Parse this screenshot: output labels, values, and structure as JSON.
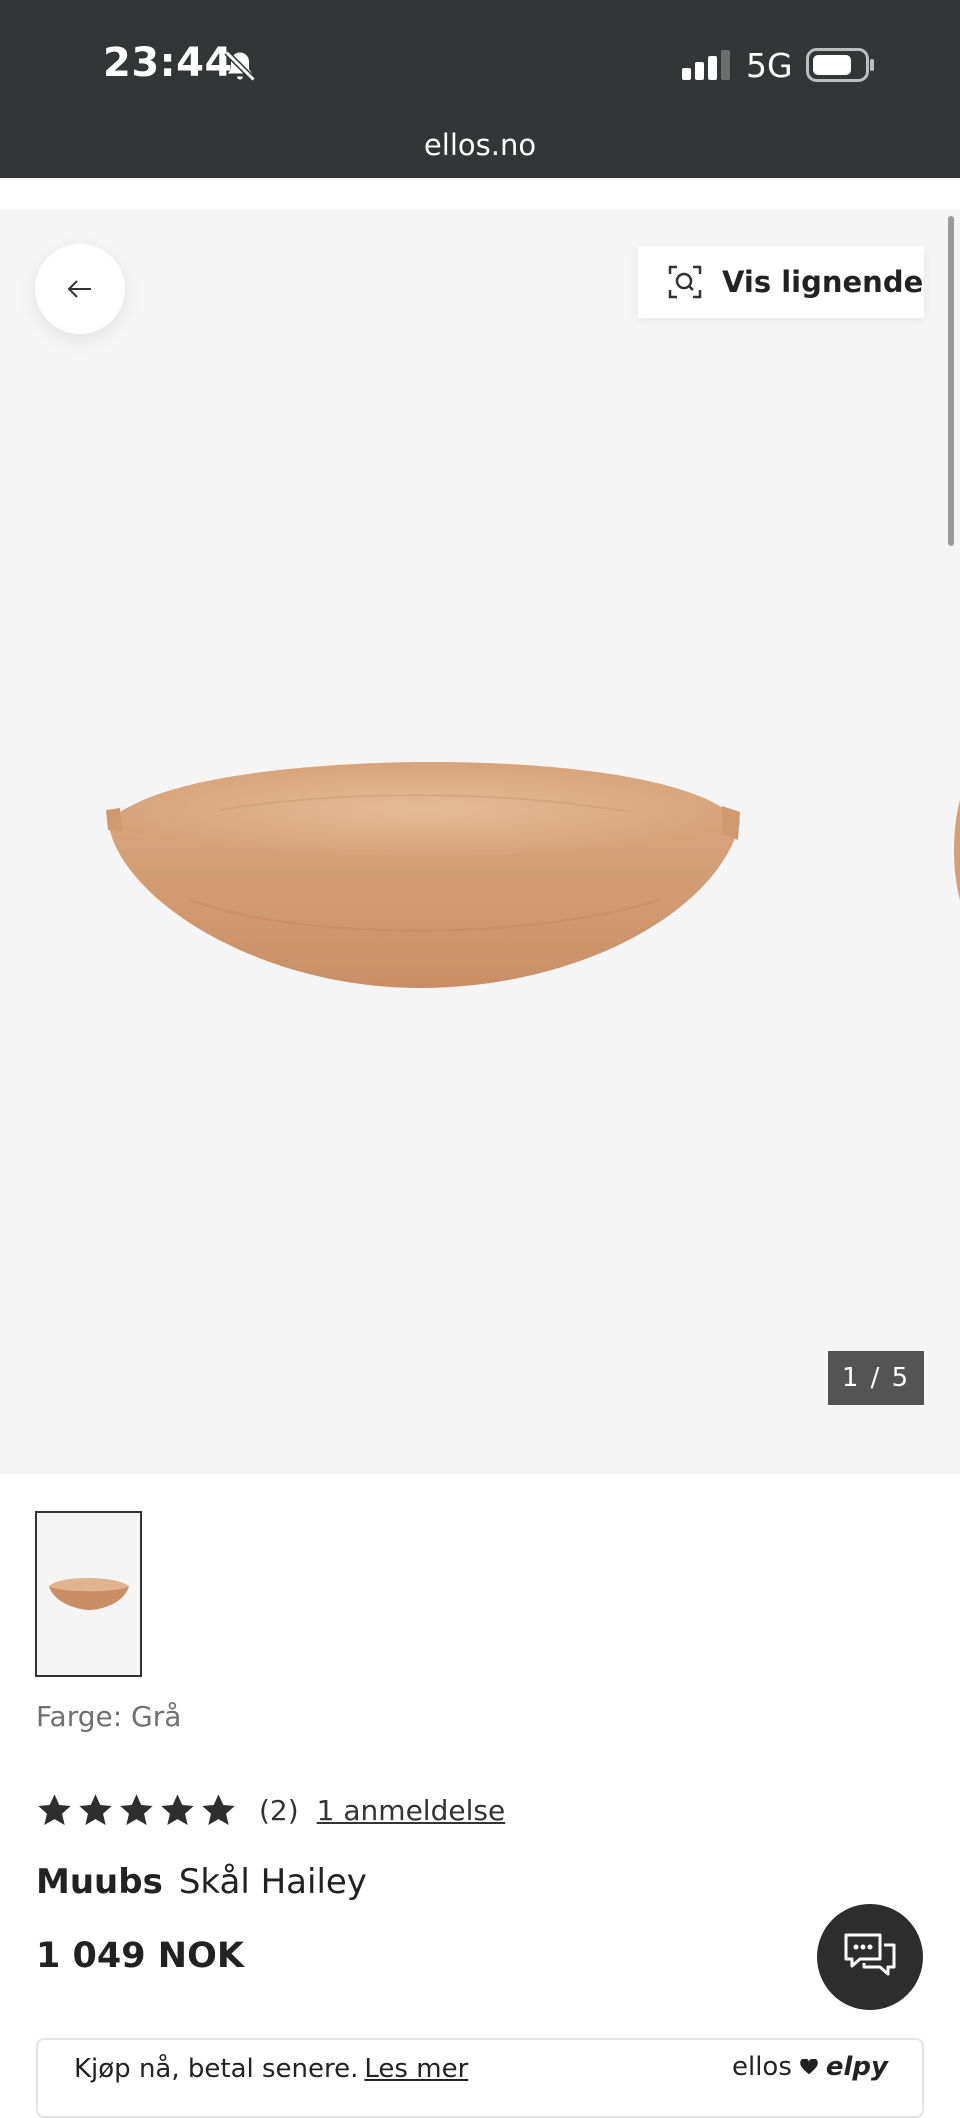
{
  "status_bar": {
    "time": "23:44",
    "network": "5G",
    "url": "ellos.no"
  },
  "gallery": {
    "similar_label": "Vis lignende",
    "counter": "1 / 5"
  },
  "product": {
    "color_label": "Farge: Grå",
    "rating_stars": 5,
    "rating_count": "(2)",
    "reviews_link": "1 anmeldelse",
    "brand": "Muubs",
    "name": "Skål Hailey",
    "price": "1 049 NOK"
  },
  "payment_banner": {
    "text": "Kjøp nå, betal senere.",
    "link": "Les mer",
    "logo_ellos": "ellos",
    "logo_elpy": "elpy"
  },
  "colors": {
    "status_bar_bg": "#333537",
    "gallery_bg": "#f5f5f5",
    "counter_bg": "#545454",
    "chat_button_bg": "#2d2d2d"
  }
}
